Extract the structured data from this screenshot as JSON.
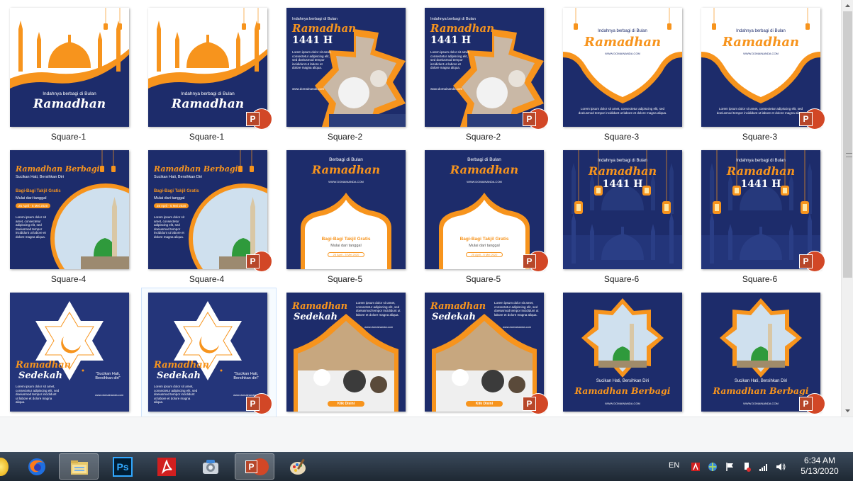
{
  "files": [
    {
      "name": "Square-1",
      "design": 1,
      "ppt": false,
      "selected": false
    },
    {
      "name": "Square-1",
      "design": 1,
      "ppt": true,
      "selected": false
    },
    {
      "name": "Square-2",
      "design": 2,
      "ppt": false,
      "selected": false
    },
    {
      "name": "Square-2",
      "design": 2,
      "ppt": true,
      "selected": false
    },
    {
      "name": "Square-3",
      "design": 3,
      "ppt": false,
      "selected": false
    },
    {
      "name": "Square-3",
      "design": 3,
      "ppt": true,
      "selected": false
    },
    {
      "name": "Square-4",
      "design": 4,
      "ppt": false,
      "selected": false
    },
    {
      "name": "Square-4",
      "design": 4,
      "ppt": true,
      "selected": false
    },
    {
      "name": "Square-5",
      "design": 5,
      "ppt": false,
      "selected": false
    },
    {
      "name": "Square-5",
      "design": 5,
      "ppt": true,
      "selected": false
    },
    {
      "name": "Square-6",
      "design": 6,
      "ppt": false,
      "selected": false
    },
    {
      "name": "Square-6",
      "design": 6,
      "ppt": true,
      "selected": false
    },
    {
      "name": "",
      "design": 7,
      "ppt": false,
      "selected": false
    },
    {
      "name": "",
      "design": 7,
      "ppt": true,
      "selected": true
    },
    {
      "name": "",
      "design": 8,
      "ppt": false,
      "selected": false
    },
    {
      "name": "",
      "design": 8,
      "ppt": true,
      "selected": false
    },
    {
      "name": "",
      "design": 9,
      "ppt": false,
      "selected": false
    },
    {
      "name": "",
      "design": 9,
      "ppt": true,
      "selected": false
    }
  ],
  "designs": {
    "d1": {
      "line1": "Indahnya berbagi di Bulan",
      "title": "Ramadhan"
    },
    "d2": {
      "title": "Ramadhan",
      "year": "1441 H",
      "line1": "Indahnya berbagi di Bulan",
      "url": "www.domainanda.com"
    },
    "d3": {
      "line1": "Indahnya berbagi di Bulan",
      "title": "Ramadhan",
      "url": "WWW.DOMAINANDA.COM"
    },
    "d4": {
      "title": "Ramadhan Berbagi",
      "sub": "Sucikan Hati, Bersihkan Diri",
      "event": "Bagi-Bagi Takjil Gratis",
      "date_label": "Mulai dari tanggal",
      "date": "25 April - 5 Mei 2020"
    },
    "d5": {
      "line1": "Berbagi di Bulan",
      "title": "Ramadhan",
      "url": "WWW.DOMAINANDA.COM",
      "event": "Bagi-Bagi Takjil Gratis",
      "date_label": "Mulai dari tanggal",
      "date": "25 April - 5 Mei 2020"
    },
    "d6": {
      "line1": "Indahnya berbagi di Bulan",
      "title": "Ramadhan",
      "year": "1441 H"
    },
    "d7": {
      "title1": "Ramadhan",
      "title2": "Sedekah",
      "quote": "\"Sucikan Hati, Bersihkan diri\"",
      "url": "www.domainanda.com"
    },
    "d8": {
      "title1": "Ramadhan",
      "title2": "Sedekah",
      "url": "www.domainanda.com",
      "button": "Klik Disini"
    },
    "d9": {
      "sub": "Sucikan Hati, Bersihkan Diri",
      "title": "Ramadhan Berbagi",
      "url": "WWW.DOMAINANDA.COM"
    }
  },
  "lorem": "Lorem ipsum dolor sit amet, consectetur adipiscing elit, sed doeiusmod tempor incididunt ut labore et dolore magna aliqua.",
  "ppt_badge_letter": "P",
  "colors": {
    "navy": "#1d2c6b",
    "orange": "#f7941d",
    "ppt": "#d24726"
  },
  "taskbar": {
    "apps": [
      {
        "name": "firefox"
      },
      {
        "name": "file-explorer",
        "active": true
      },
      {
        "name": "photoshop",
        "label": "Ps"
      },
      {
        "name": "acrobat"
      },
      {
        "name": "system-utility"
      },
      {
        "name": "powerpoint",
        "label": "P"
      },
      {
        "name": "paint"
      }
    ],
    "tray": {
      "lang": "EN"
    },
    "clock": {
      "time": "6:34 AM",
      "date": "5/13/2020"
    }
  }
}
